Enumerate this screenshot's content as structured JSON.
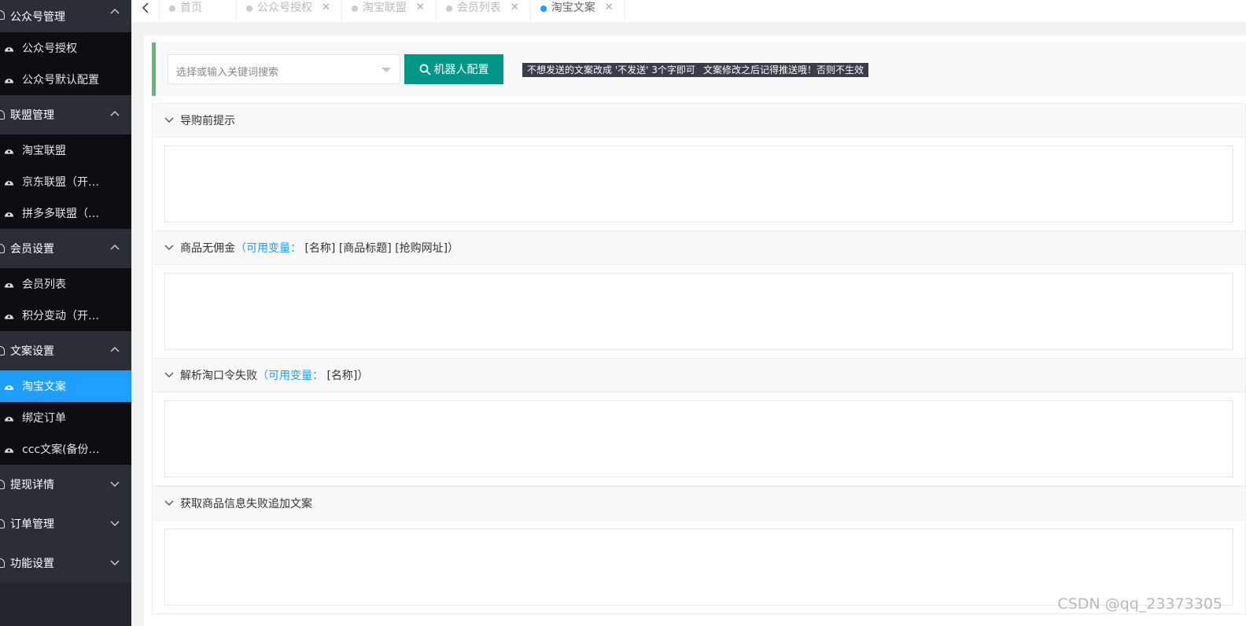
{
  "sidebar": {
    "groups": [
      {
        "label": "公众号管理",
        "expanded": true,
        "items": [
          {
            "label": "公众号授权"
          },
          {
            "label": "公众号默认配置"
          }
        ]
      },
      {
        "label": "联盟管理",
        "expanded": true,
        "items": [
          {
            "label": "淘宝联盟"
          },
          {
            "label": "京东联盟（开…"
          },
          {
            "label": "拼多多联盟（…"
          }
        ]
      },
      {
        "label": "会员设置",
        "expanded": true,
        "items": [
          {
            "label": "会员列表"
          },
          {
            "label": "积分变动（开…"
          }
        ]
      },
      {
        "label": "文案设置",
        "expanded": true,
        "items": [
          {
            "label": "淘宝文案",
            "active": true
          },
          {
            "label": "绑定订单"
          },
          {
            "label": "ccc文案(备份…"
          }
        ]
      },
      {
        "label": "提现详情",
        "expanded": false
      },
      {
        "label": "订单管理",
        "expanded": false
      },
      {
        "label": "功能设置",
        "expanded": false
      }
    ]
  },
  "tabs": [
    {
      "label": "首页",
      "closable": false
    },
    {
      "label": "公众号授权",
      "closable": true
    },
    {
      "label": "淘宝联盟",
      "closable": true
    },
    {
      "label": "会员列表",
      "closable": true
    },
    {
      "label": "淘宝文案",
      "closable": true,
      "active": true
    }
  ],
  "toolbar": {
    "search_placeholder": "选择或输入关键词搜索",
    "robot_button": "机器人配置",
    "notice1": "不想发送的文案改成 '不发送' 3个字即可",
    "notice2": "文案修改之后记得推送哦！否则不生效"
  },
  "sections": [
    {
      "title": "导购前提示",
      "hint_prefix": "",
      "hint": "",
      "vars": "",
      "hint_suffix": ""
    },
    {
      "title": "商品无佣金",
      "hint_prefix": "（",
      "hint": "可用变量：",
      "vars": " [名称] [商品标题] [抢购网址]",
      "hint_suffix": "）"
    },
    {
      "title": "解析淘口令失败",
      "hint_prefix": "（",
      "hint": "可用变量：",
      "vars": " [名称]",
      "hint_suffix": "）"
    },
    {
      "title": "获取商品信息失败追加文案",
      "hint_prefix": "",
      "hint": "",
      "vars": "",
      "hint_suffix": ""
    }
  ],
  "watermark": "CSDN @qq_23373305",
  "colors": {
    "sidebar_bg": "#23262e",
    "active_blue": "#1e9fff",
    "button_teal": "#009688",
    "toolbar_accent": "#5fb878"
  }
}
